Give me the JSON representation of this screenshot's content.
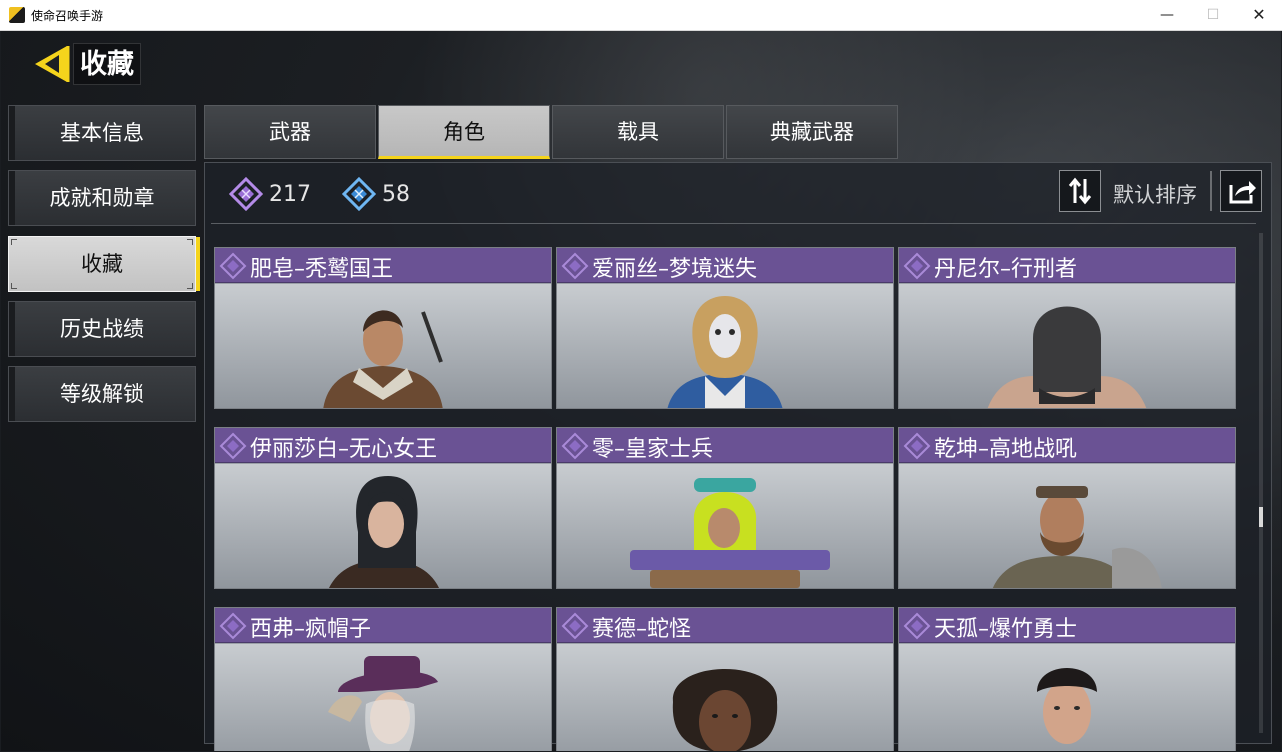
{
  "window": {
    "title": "使命召唤手游",
    "minimize": "—",
    "maximize": "☐",
    "close": "✕"
  },
  "header": {
    "title": "收藏"
  },
  "sidebar": {
    "items": [
      {
        "label": "基本信息",
        "active": false
      },
      {
        "label": "成就和勋章",
        "active": false
      },
      {
        "label": "收藏",
        "active": true
      },
      {
        "label": "历史战绩",
        "active": false
      },
      {
        "label": "等级解锁",
        "active": false
      }
    ]
  },
  "tabs": [
    {
      "label": "武器",
      "active": false
    },
    {
      "label": "角色",
      "active": true
    },
    {
      "label": "载具",
      "active": false
    },
    {
      "label": "典藏武器",
      "active": false
    }
  ],
  "stats": {
    "purple_count": "217",
    "blue_count": "58"
  },
  "sort": {
    "label": "默认排序"
  },
  "colors": {
    "accent": "#f5d41c",
    "rarity_purple": "#6a5294",
    "rarity_blue": "#3a8ad6"
  },
  "characters": [
    {
      "name": "肥皂–秃鹫国王"
    },
    {
      "name": "爱丽丝–梦境迷失"
    },
    {
      "name": "丹尼尔–行刑者"
    },
    {
      "name": "伊丽莎白–无心女王"
    },
    {
      "name": "零–皇家士兵"
    },
    {
      "name": "乾坤–高地战吼"
    },
    {
      "name": "西弗–疯帽子"
    },
    {
      "name": "赛德–蛇怪"
    },
    {
      "name": "天孤–爆竹勇士"
    }
  ]
}
